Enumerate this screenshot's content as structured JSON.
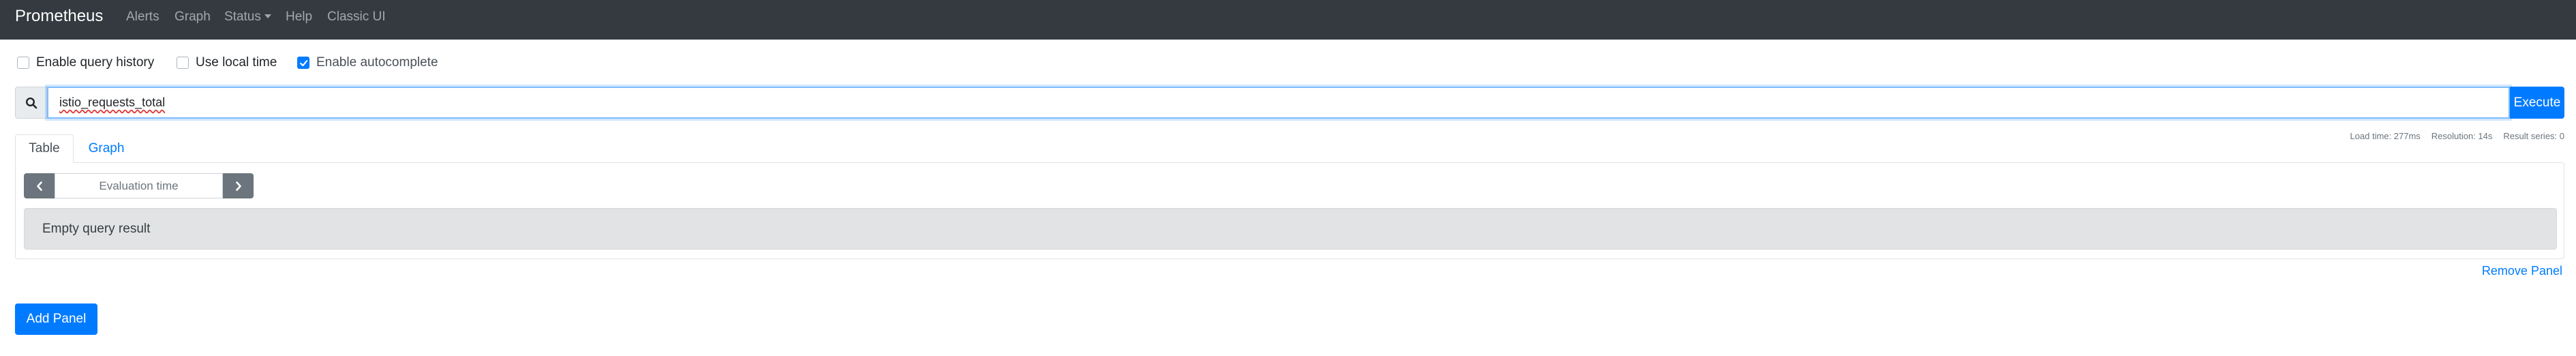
{
  "navbar": {
    "brand": "Prometheus",
    "links": [
      "Alerts",
      "Graph",
      "Status",
      "Help",
      "Classic UI"
    ]
  },
  "options": [
    {
      "label": "Enable query history",
      "checked": false
    },
    {
      "label": "Use local time",
      "checked": false
    },
    {
      "label": "Enable autocomplete",
      "checked": true
    }
  ],
  "query": {
    "value": "istio_requests_total",
    "search_icon": "search-icon",
    "execute_label": "Execute"
  },
  "stats": {
    "load_time": "Load time: 277ms",
    "resolution": "Resolution: 14s",
    "result_series": "Result series: 0"
  },
  "tabs": {
    "table": "Table",
    "graph": "Graph",
    "active": "Table"
  },
  "panel": {
    "eval_placeholder": "Evaluation time",
    "prev_icon": "chevron-left-icon",
    "next_icon": "chevron-right-icon",
    "empty_message": "Empty query result",
    "remove_label": "Remove Panel"
  },
  "add_panel_label": "Add Panel",
  "colors": {
    "navbar_bg": "#343a40",
    "primary": "#007bff",
    "secondary": "#6c757d",
    "alert_bg": "#e2e3e5"
  }
}
